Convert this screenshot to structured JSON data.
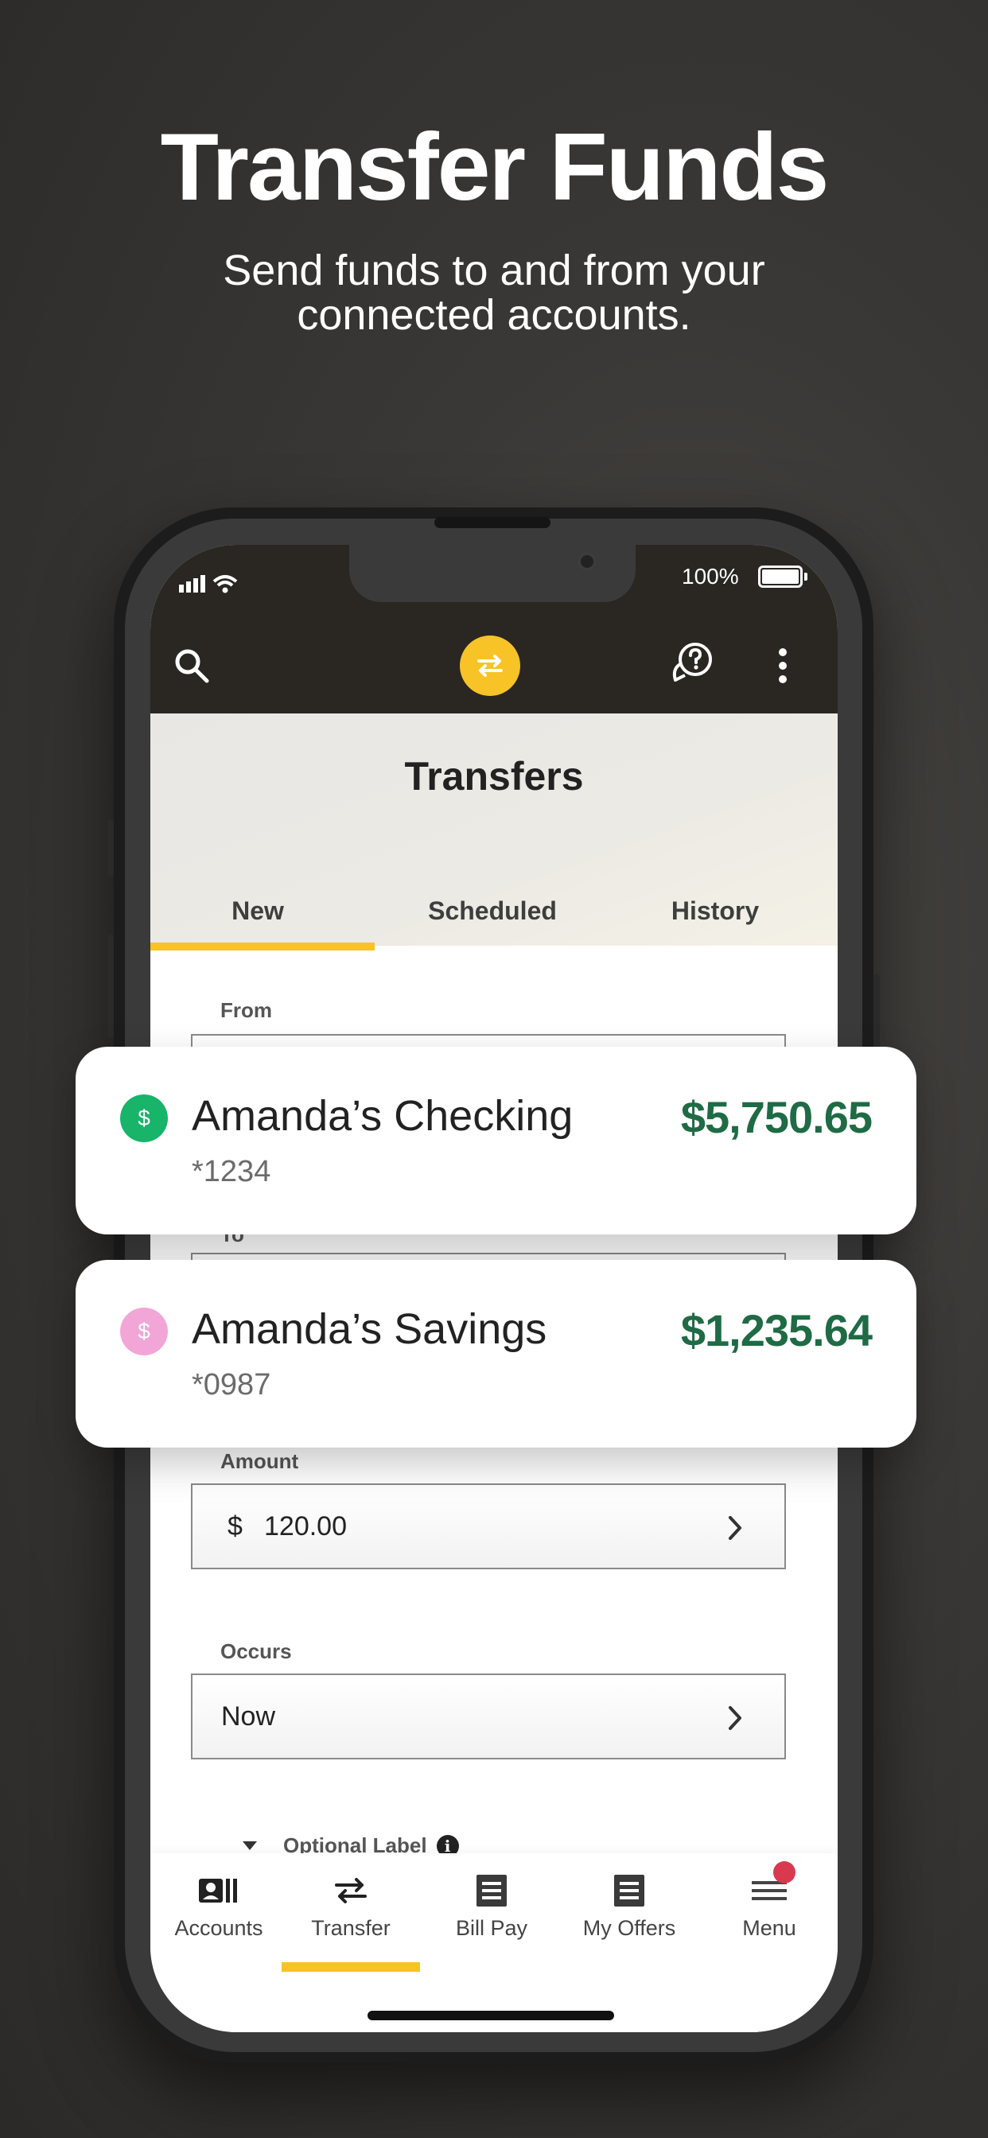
{
  "hero": {
    "title": "Transfer Funds",
    "subtitle": "Send funds to and from your connected accounts."
  },
  "status_bar": {
    "battery": "100%"
  },
  "app_bar": {
    "icons": [
      "search-icon",
      "transfer-icon",
      "help-chat-icon",
      "more-vertical-icon"
    ],
    "accent": "#f7c326"
  },
  "page": {
    "title": "Transfers",
    "tabs": [
      {
        "label": "New",
        "active": true
      },
      {
        "label": "Scheduled",
        "active": false
      },
      {
        "label": "History",
        "active": false
      }
    ]
  },
  "form": {
    "from_label": "From",
    "to_label": "To",
    "amount_label": "Amount",
    "amount_currency": "$",
    "amount_value": "120.00",
    "occurs_label": "Occurs",
    "occurs_value": "Now",
    "optional_label": "Optional Label"
  },
  "accounts": [
    {
      "name": "Amanda’s Checking",
      "number": "*1234",
      "balance": "$5,750.65",
      "icon_color": "#17b46a"
    },
    {
      "name": "Amanda’s Savings",
      "number": "*0987",
      "balance": "$1,235.64",
      "icon_color": "#f2a6d8"
    }
  ],
  "bottom_nav": {
    "items": [
      {
        "label": "Accounts",
        "icon": "accounts-icon"
      },
      {
        "label": "Transfer",
        "icon": "transfer-icon",
        "active": true
      },
      {
        "label": "Bill Pay",
        "icon": "bill-icon"
      },
      {
        "label": "My Offers",
        "icon": "offers-icon"
      },
      {
        "label": "Menu",
        "icon": "hamburger-icon",
        "badge": true
      }
    ]
  },
  "colors": {
    "balance": "#1f6b45",
    "badge": "#d9394f"
  }
}
